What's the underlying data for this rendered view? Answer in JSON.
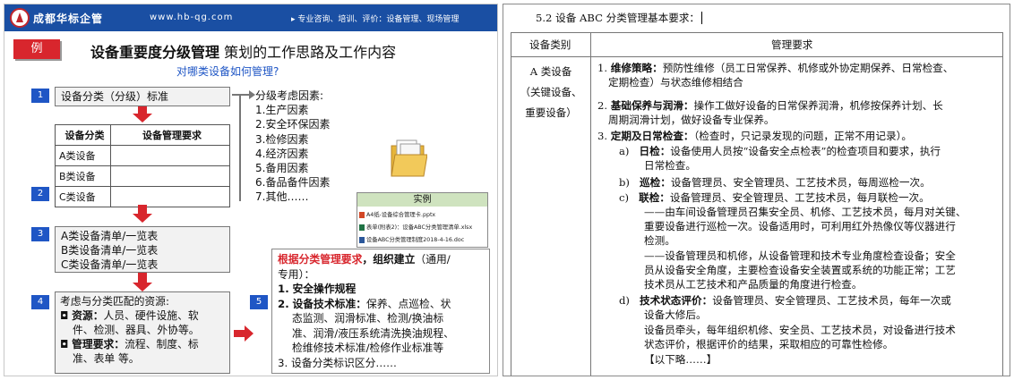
{
  "slide": {
    "header": {
      "company": "成都华标企管",
      "website": "www.hb-qg.com",
      "services": "▸ 专业咨询、培训、评价：设备管理、现场管理"
    },
    "example_tag": "例",
    "title_bold": "设备重要度分级管理",
    "title_rest": " 策划的工作思路及工作内容",
    "subtitle": "对哪类设备如何管理?",
    "step1": {
      "num": "1",
      "label": "设备分类（分级）标准"
    },
    "factors": {
      "heading": "分级考虑因素:",
      "items": [
        "1.生产因素",
        "2.安全环保因素",
        "3.检修因素",
        "4.经济因素",
        "5.备用因素",
        "6.备品备件因素",
        "7.其他……"
      ]
    },
    "table": {
      "headers": [
        "设备分类",
        "设备管理要求"
      ],
      "rows": [
        [
          "A类设备",
          ""
        ],
        [
          "B类设备",
          ""
        ],
        [
          "C类设备",
          ""
        ]
      ]
    },
    "step2": {
      "num": "2"
    },
    "example_box": {
      "title": "实例",
      "files": [
        "A4纸-设备综合管理卡.pptx",
        "表单(附表2)：设备ABC分类管理清单.xlsx",
        "设备ABC分类管理制度2018-4-16.doc"
      ]
    },
    "step3": {
      "num": "3",
      "lines": [
        "A类设备清单/一览表",
        "B类设备清单/一览表",
        "C类设备清单/一览表"
      ]
    },
    "step4": {
      "num": "4",
      "intro": "考虑与分类匹配的资源:",
      "res1_label": "资源：",
      "res1_text": "人员、硬件设施、软",
      "res1_cont": "件、检测、器具、外协等。",
      "res2_label": "管理要求：",
      "res2_text": "流程、制度、标",
      "res2_cont": "准、表单 等。"
    },
    "step5": {
      "num": "5",
      "red_text": "根据分类管理要求",
      "org_text": "，组织建立",
      "org_tail": "（通用/",
      "org_tail2": "专用）：",
      "item1_num": "1.",
      "item1": "安全操作规程",
      "item2_num": "2.",
      "item2_label": "设备技术标准：",
      "item2_text": "保养、点巡检、状",
      "item2_l2": "态监测、润滑标准、检测/换油标",
      "item2_l3": "准、润滑/液压系统清洗换油规程、",
      "item2_l4": "检维修技术标准/检修作业标准等",
      "item3": "3.  设备分类标识区分……"
    }
  },
  "doc": {
    "heading": "5.2 设备 ABC 分类管理基本要求：",
    "col1": "设备类别",
    "col2": "管理要求",
    "cat_a": [
      "A 类设备",
      "（关键设备、",
      "重要设备）"
    ],
    "lines": {
      "l1a": "1.",
      "l1b": "维修策略：",
      "l1c": "预防性维修（员工日常保养、机修或外协定期保养、日常检查、",
      "l1d": "定期检查）与状态维修相结合",
      "l2a": "2.",
      "l2b": "基础保养与润滑：",
      "l2c": "操作工做好设备的日常保养润滑，机修按保养计划、长",
      "l2d": "周期润滑计划，做好设备专业保养。",
      "l3a": "3.",
      "l3b": "定期及日常检查：",
      "l3c": "（检查时，只记录发现的问题，正常不用记录）。",
      "a_m": "a)",
      "a_b": "日检：",
      "a_t": "设备使用人员按“设备安全点检表”的检查项目和要求，执行",
      "a_t2": "日常检查。",
      "b_m": "b)",
      "b_b": "巡检：",
      "b_t": "设备管理员、安全管理员、工艺技术员，每周巡检一次。",
      "c_m": "c)",
      "c_b": "联检：",
      "c_t": "设备管理员、安全管理员、工艺技术员，每月联检一次。",
      "c_l2": "——由车间设备管理员召集安全员、机修、工艺技术员，每月对关键、",
      "c_l3": "重要设备进行巡检一次。设备适用时，可利用红外热像仪等仪器进行",
      "c_l4": "检测。",
      "c_l5": "——设备管理员和机修，从设备管理和技术专业角度检查设备；安全",
      "c_l6": "员从设备安全角度，主要检查设备安全装置或系统的功能正常；工艺",
      "c_l7": "技术员从工艺技术和产品质量的角度进行检查。",
      "d_m": "d)",
      "d_b": "技术状态评价：",
      "d_t": "设备管理员、安全管理员、工艺技术员，每年一次或",
      "d_t2": "设备大修后。",
      "d_t3": "设备员牵头，每年组织机修、安全员、工艺技术员，对设备进行技术",
      "d_t4": "状态评价，根据评价的结果，采取相应的可靠性检修。",
      "more": "【以下略……】"
    }
  },
  "colors": {
    "header_blue": "#1a4fa3",
    "accent_red": "#d8262d",
    "link_blue": "#1f56c5",
    "example_green": "#cfe3bf"
  }
}
